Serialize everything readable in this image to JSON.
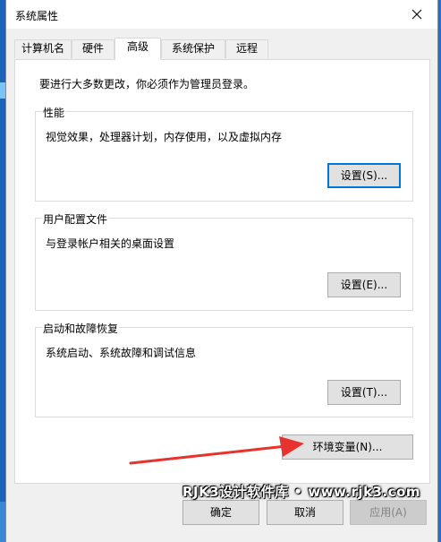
{
  "window": {
    "title": "系统属性"
  },
  "tabs": [
    {
      "label": "计算机名",
      "active": false
    },
    {
      "label": "硬件",
      "active": false
    },
    {
      "label": "高级",
      "active": true
    },
    {
      "label": "系统保护",
      "active": false
    },
    {
      "label": "远程",
      "active": false
    }
  ],
  "advanced": {
    "admin_note": "要进行大多数更改，你必须作为管理员登录。",
    "performance": {
      "title": "性能",
      "description": "视觉效果，处理器计划，内存使用，以及虚拟内存",
      "button": "设置(S)..."
    },
    "user_profiles": {
      "title": "用户配置文件",
      "description": "与登录帐户相关的桌面设置",
      "button": "设置(E)..."
    },
    "startup_recovery": {
      "title": "启动和故障恢复",
      "description": "系统启动、系统故障和调试信息",
      "button": "设置(T)..."
    },
    "env_button": "环境变量(N)..."
  },
  "footer": {
    "ok": "确定",
    "cancel": "取消",
    "apply": "应用(A)"
  },
  "watermark": "RJK3设计软件库 • www.rjk3.com",
  "colors": {
    "accent": "#0078d7",
    "arrow": "#e8322d"
  }
}
